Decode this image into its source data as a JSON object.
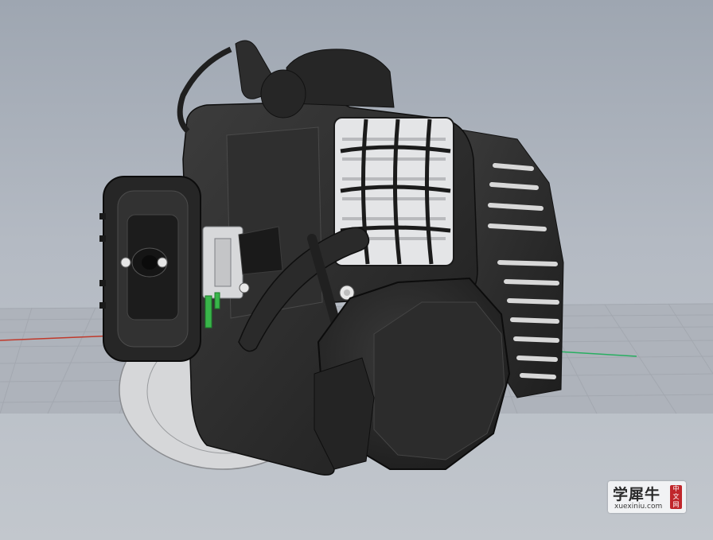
{
  "viewport": {
    "view": "3D perspective viewport",
    "background_color": "#b4bac3",
    "grid_color": "#a3a8b0",
    "axis_x_color": "#c0392b",
    "axis_y_color": "#27ae60",
    "model": {
      "body_color": "#2b2b2b",
      "highlight_color": "#5a5a5a",
      "transparent_part_color": "#d9dadc",
      "accent_color": "#39b54a"
    }
  },
  "watermark": {
    "main_text": "学犀牛",
    "site_text": "xuexiniu.com",
    "stamp_chars": [
      "中",
      "文",
      "网"
    ],
    "stamp_color": "#c0262b"
  }
}
